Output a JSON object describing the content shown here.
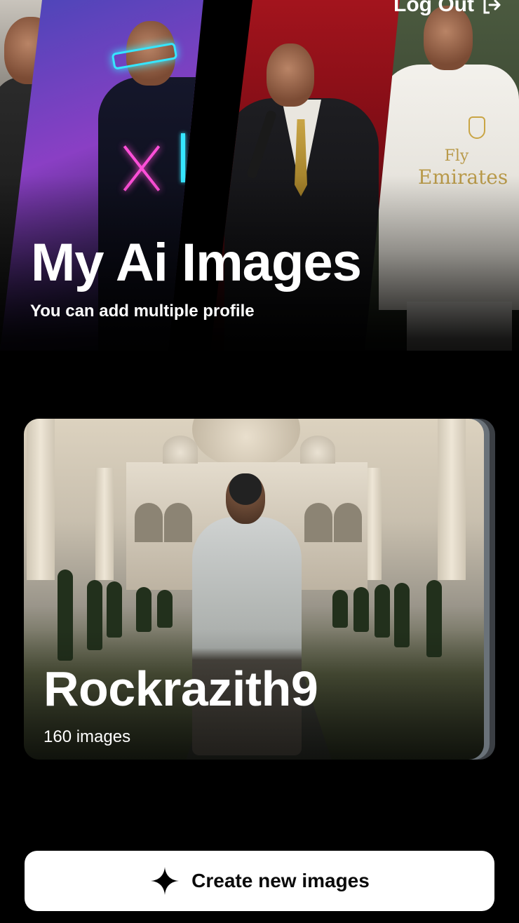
{
  "header": {
    "logout_label": "Log Out",
    "logout_icon": "logout-icon"
  },
  "hero": {
    "title": "My Ai Images",
    "subtitle": "You can add multiple profile",
    "jersey_line1": "Fly",
    "jersey_line2": "Emirates"
  },
  "profiles": [
    {
      "name": "Rockrazith9",
      "count_label": "160 images"
    }
  ],
  "cta": {
    "label": "Create new images",
    "icon": "sparkle-icon"
  },
  "colors": {
    "background": "#000000",
    "cta_background": "#ffffff",
    "text": "#ffffff"
  }
}
